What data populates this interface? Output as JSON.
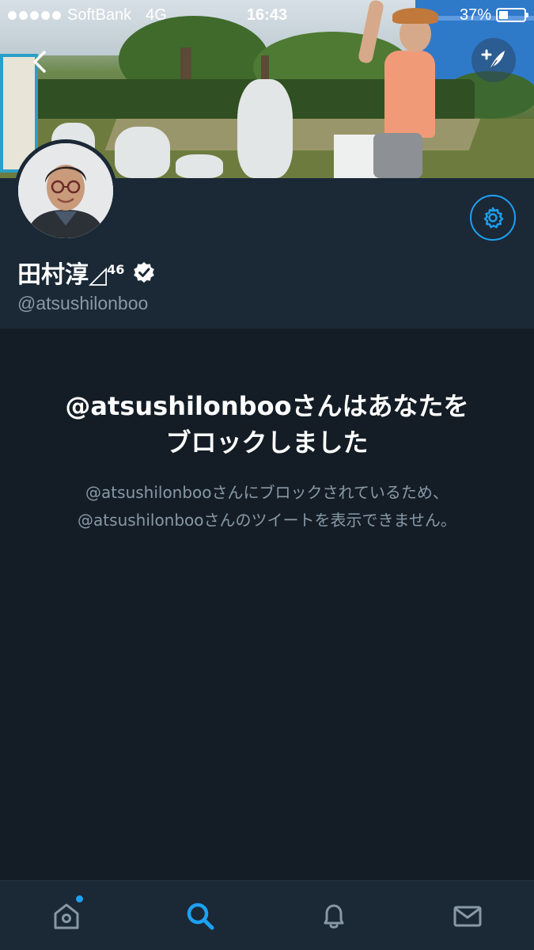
{
  "status_bar": {
    "carrier": "SoftBank",
    "network": "4G",
    "time": "16:43",
    "battery": "37%",
    "battery_level": 0.37
  },
  "profile": {
    "display_name": "田村淳◿",
    "name_superscript": "46",
    "handle": "@atsushilonboo",
    "verified": true
  },
  "blocked": {
    "title_line1": "@atsushilonbooさんはあなたを",
    "title_line2": "ブロックしました",
    "subtitle_line1": "@atsushilonbooさんにブロックされているため、",
    "subtitle_line2": "@atsushilonbooさんのツイートを表示できません。"
  },
  "tabs": [
    {
      "icon": "home-icon",
      "active": false,
      "has_badge": true
    },
    {
      "icon": "search-icon",
      "active": true,
      "has_badge": false
    },
    {
      "icon": "bell-icon",
      "active": false,
      "has_badge": false
    },
    {
      "icon": "mail-icon",
      "active": false,
      "has_badge": false
    }
  ],
  "colors": {
    "accent": "#1da1f2",
    "background": "#141d26",
    "header_bg": "#1b2836",
    "muted_text": "#8899a6",
    "inactive_icon": "#8899a6"
  }
}
